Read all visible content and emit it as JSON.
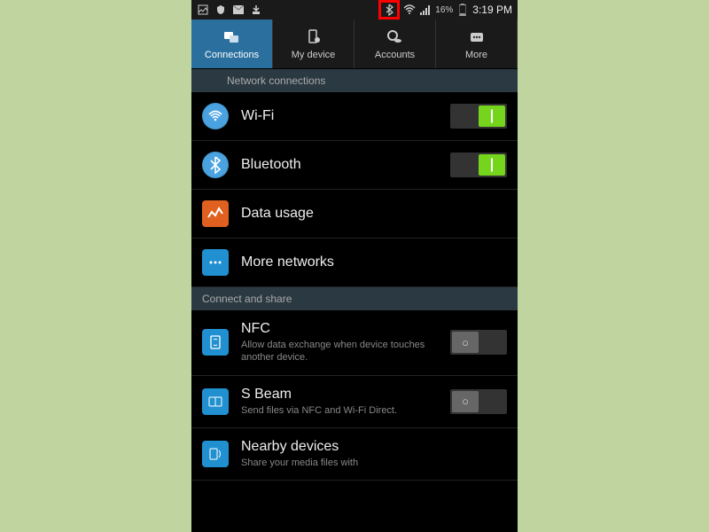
{
  "status_bar": {
    "battery": "16%",
    "time": "3:19 PM"
  },
  "tabs": [
    {
      "label": "Connections"
    },
    {
      "label": "My device"
    },
    {
      "label": "Accounts"
    },
    {
      "label": "More"
    }
  ],
  "sections": {
    "network": {
      "header": "Network connections",
      "wifi": {
        "label": "Wi-Fi",
        "on": true
      },
      "bluetooth": {
        "label": "Bluetooth",
        "on": true
      },
      "data_usage": {
        "label": "Data usage"
      },
      "more_networks": {
        "label": "More networks"
      }
    },
    "connect_share": {
      "header": "Connect and share",
      "nfc": {
        "label": "NFC",
        "sub": "Allow data exchange when device touches another device.",
        "on": false
      },
      "sbeam": {
        "label": "S Beam",
        "sub": "Send files via NFC and Wi-Fi Direct.",
        "on": false
      },
      "nearby": {
        "label": "Nearby devices",
        "sub": "Share your media files with"
      }
    }
  }
}
